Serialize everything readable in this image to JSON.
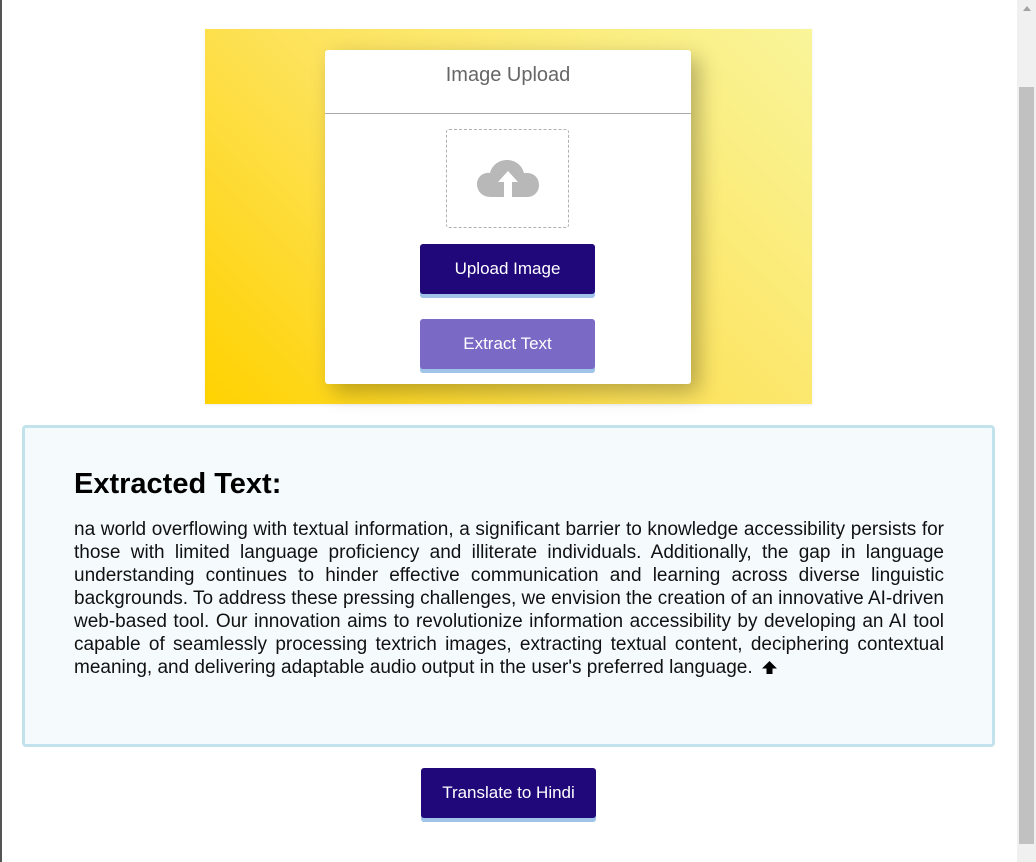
{
  "upload_card": {
    "title": "Image Upload",
    "dropzone_icon": "cloud-upload-icon",
    "upload_button_label": "Upload Image",
    "extract_button_label": "Extract Text"
  },
  "result": {
    "title": "Extracted Text:",
    "text": "na world overflowing with textual information, a significant barrier to knowledge accessibility persists for those with limited language proficiency and illiterate individuals. Additionally, the gap in language understanding continues to hinder effective communication and learning across diverse linguistic backgrounds. To address these pressing challenges, we envision the creation of an innovative AI-driven web-based tool. Our innovation aims to revolutionize information accessibility by developing an AI tool capable of seamlessly processing textrich images, extracting textual content, deciphering contextual meaning, and delivering adaptable audio output in the user's preferred language.",
    "trailing_icon": "arrow-up-icon"
  },
  "translate_button_label": "Translate to Hindi",
  "colors": {
    "primary_button": "#20087a",
    "secondary_button": "#7b69c6",
    "button_underline": "#9fc3e9",
    "result_border": "#c2e3ec",
    "result_background": "#f5fbfd",
    "gradient_start": "#ffd200",
    "gradient_end": "#f9f59a"
  }
}
